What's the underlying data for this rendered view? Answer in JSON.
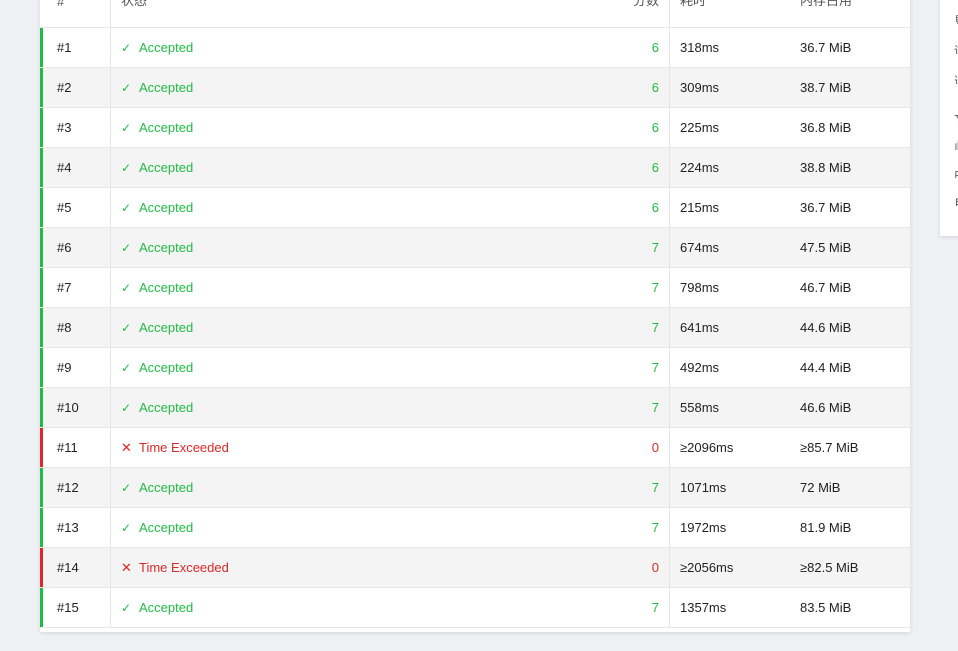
{
  "table": {
    "headers": {
      "id": "#",
      "status": "状态",
      "score": "分数",
      "time": "耗时",
      "memory": "内存占用"
    },
    "rows": [
      {
        "id": "#1",
        "status": "Accepted",
        "score": "6",
        "time": "318ms",
        "memory": "36.7 MiB"
      },
      {
        "id": "#2",
        "status": "Accepted",
        "score": "6",
        "time": "309ms",
        "memory": "38.7 MiB"
      },
      {
        "id": "#3",
        "status": "Accepted",
        "score": "6",
        "time": "225ms",
        "memory": "36.8 MiB"
      },
      {
        "id": "#4",
        "status": "Accepted",
        "score": "6",
        "time": "224ms",
        "memory": "38.8 MiB"
      },
      {
        "id": "#5",
        "status": "Accepted",
        "score": "6",
        "time": "215ms",
        "memory": "36.7 MiB"
      },
      {
        "id": "#6",
        "status": "Accepted",
        "score": "7",
        "time": "674ms",
        "memory": "47.5 MiB"
      },
      {
        "id": "#7",
        "status": "Accepted",
        "score": "7",
        "time": "798ms",
        "memory": "46.7 MiB"
      },
      {
        "id": "#8",
        "status": "Accepted",
        "score": "7",
        "time": "641ms",
        "memory": "44.6 MiB"
      },
      {
        "id": "#9",
        "status": "Accepted",
        "score": "7",
        "time": "492ms",
        "memory": "44.4 MiB"
      },
      {
        "id": "#10",
        "status": "Accepted",
        "score": "7",
        "time": "558ms",
        "memory": "46.6 MiB"
      },
      {
        "id": "#11",
        "status": "Time Exceeded",
        "score": "0",
        "time": "≥2096ms",
        "memory": "≥85.7 MiB"
      },
      {
        "id": "#12",
        "status": "Accepted",
        "score": "7",
        "time": "1071ms",
        "memory": "72 MiB"
      },
      {
        "id": "#13",
        "status": "Accepted",
        "score": "7",
        "time": "1972ms",
        "memory": "81.9 MiB"
      },
      {
        "id": "#14",
        "status": "Time Exceeded",
        "score": "0",
        "time": "≥2056ms",
        "memory": "≥82.5 MiB"
      },
      {
        "id": "#15",
        "status": "Accepted",
        "score": "7",
        "time": "1357ms",
        "memory": "83.5 MiB"
      }
    ]
  },
  "colors": {
    "accepted": "#21ba45",
    "exceeded": "#db2828"
  },
  "icons": {
    "accepted": "check-icon",
    "exceeded": "cross-icon"
  }
}
